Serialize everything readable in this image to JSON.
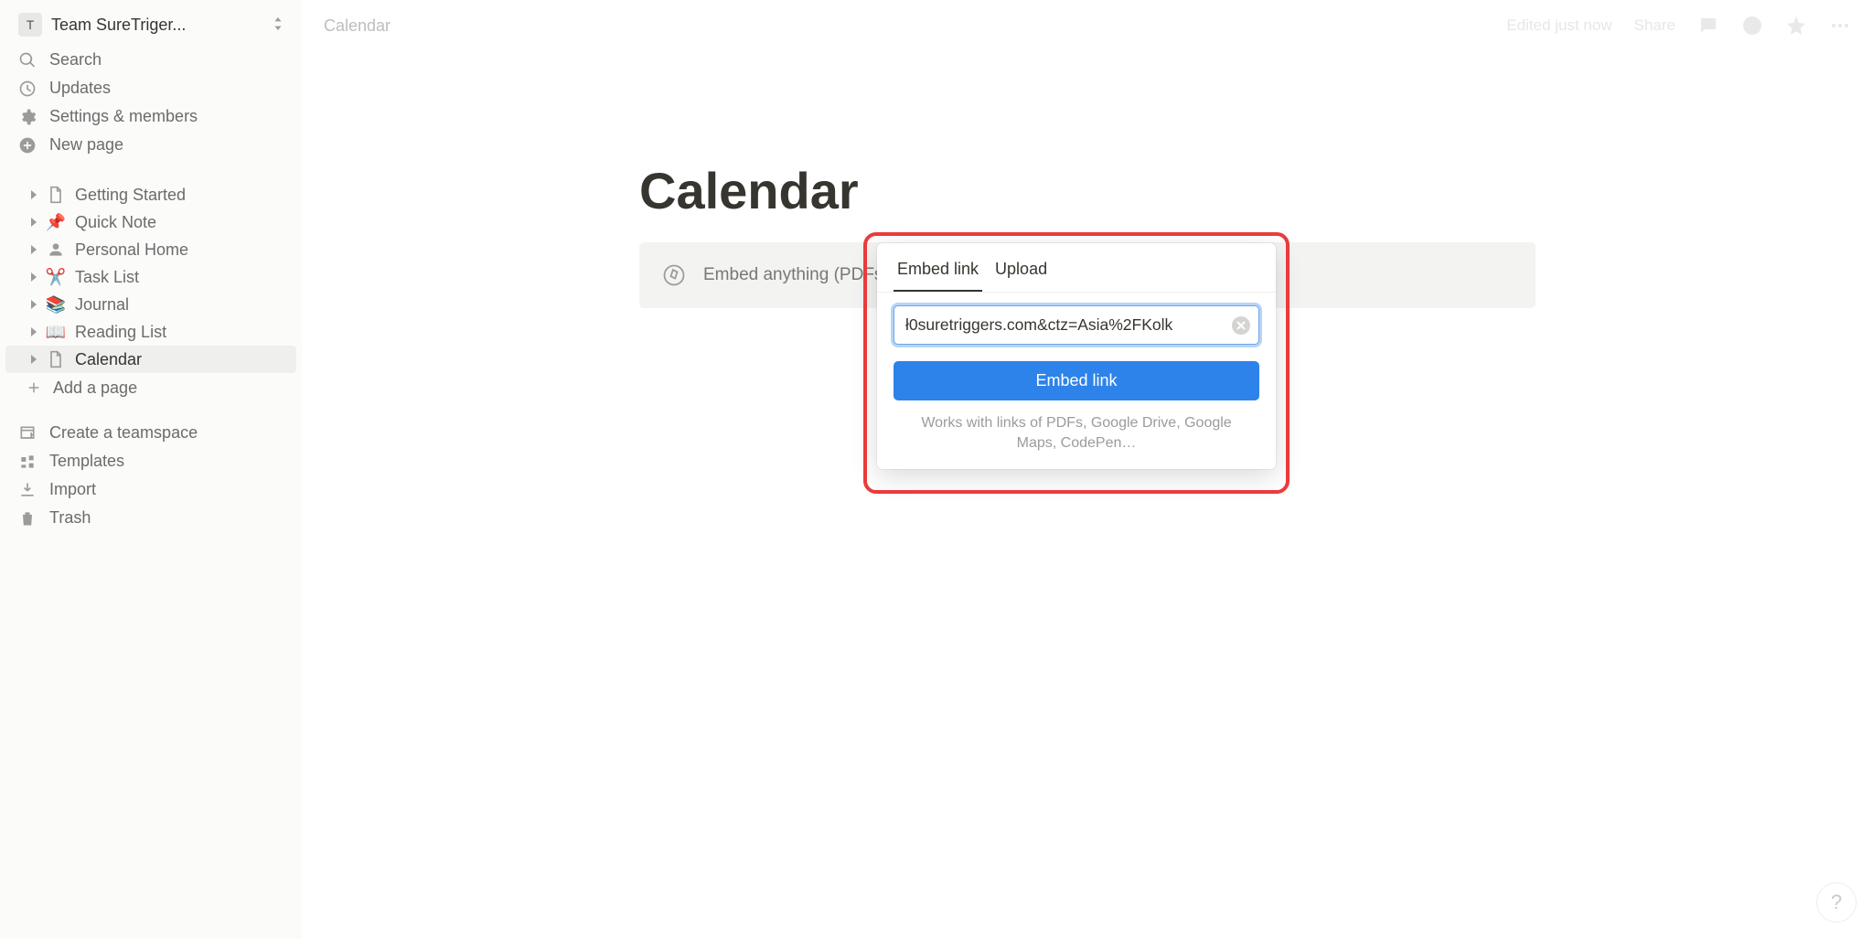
{
  "workspace": {
    "initial": "T",
    "name": "Team SureTriger..."
  },
  "nav": {
    "search": "Search",
    "updates": "Updates",
    "settings": "Settings & members",
    "new_page": "New page"
  },
  "pages": [
    {
      "label": "Getting Started",
      "icon": "doc"
    },
    {
      "label": "Quick Note",
      "icon": "pin"
    },
    {
      "label": "Personal Home",
      "icon": "person"
    },
    {
      "label": "Task List",
      "icon": "scissors"
    },
    {
      "label": "Journal",
      "icon": "books"
    },
    {
      "label": "Reading List",
      "icon": "book"
    },
    {
      "label": "Calendar",
      "icon": "doc"
    }
  ],
  "add_page": "Add a page",
  "bottom": {
    "teamspace": "Create a teamspace",
    "templates": "Templates",
    "import": "Import",
    "trash": "Trash"
  },
  "breadcrumb": "Calendar",
  "topbar": {
    "edited": "Edited just now",
    "share": "Share"
  },
  "doc": {
    "title": "Calendar",
    "embed_hint": "Embed anything (PDFs, Google Docs, Google Maps, Spotify…)"
  },
  "popover": {
    "tab_embed": "Embed link",
    "tab_upload": "Upload",
    "input_value": "ł0suretriggers.com&ctz=Asia%2FKolk",
    "button": "Embed link",
    "help": "Works with links of PDFs, Google Drive, Google Maps, CodePen…"
  },
  "help": "?"
}
